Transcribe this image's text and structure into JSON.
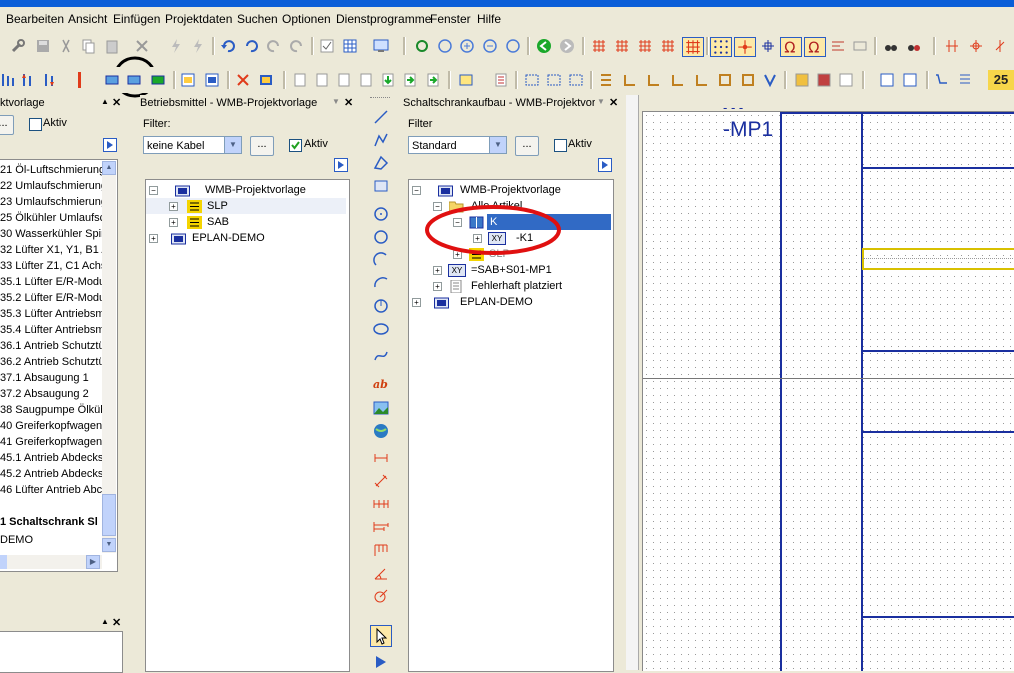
{
  "menu": [
    "Bearbeiten",
    "Ansicht",
    "Einfügen",
    "Projektdaten",
    "Suchen",
    "Optionen",
    "Dienstprogramme",
    "Fenster",
    "Hilfe"
  ],
  "panel_left": {
    "title": "ktvorlage",
    "active_label": "Aktiv",
    "items": [
      "21 Öl-Luftschmierung",
      "22 Umlaufschmierung",
      "23 Umlaufschmierung",
      "25 Ölkühler Umlaufsch",
      "30 Wasserkühler Spin",
      "32 Lüfter X1, Y1, B1 A",
      "33 Lüfter Z1, C1 Achs",
      "35.1 Lüfter E/R-Modu",
      "35.2 Lüfter E/R-Modu",
      "35.3 Lüfter Antriebsm",
      "35.4 Lüfter Antriebsm",
      "36.1 Antrieb Schutztü",
      "36.2 Antrieb Schutztü",
      "37.1 Absaugung 1",
      "37.2 Absaugung 2",
      "38 Saugpumpe Ölkühl",
      "40 Greiferkopfwagen",
      "41 Greiferkopfwagen",
      "45.1 Antrieb Abdecks",
      "45.2 Antrieb Abdecks",
      "46 Lüfter Antrieb Abc"
    ],
    "bold_item": "1 Schaltschrank Sl",
    "last_item": "DEMO"
  },
  "panel_mid": {
    "title": "Betriebsmittel - WMB-Projektvorlage",
    "filter_label": "Filter:",
    "filter_value": "keine Kabel",
    "active_label": "Aktiv",
    "tree": [
      "WMB-Projektvorlage",
      "SLP",
      "SAB",
      "EPLAN-DEMO"
    ]
  },
  "panel_right": {
    "title": "Schaltschrankaufbau - WMB-Projektvor",
    "filter_label": "Filter",
    "filter_value": "Standard",
    "active_label": "Aktiv",
    "tree": [
      "WMB-Projektvorlage",
      "Alle Artikel",
      "K",
      "-K1",
      "SLP",
      "=SAB+S01-MP1",
      "Fehlerhaft platziert",
      "EPLAN-DEMO"
    ],
    "xy_badge": "XY"
  },
  "canvas": {
    "label": "-MP1",
    "top_label": "- - -"
  },
  "toolbar2_badge": "25",
  "colors": {
    "accent_blue": "#1a2f9f",
    "selection": "#316ac5",
    "annotation_red": "#e01010",
    "annotation_black": "#000000"
  }
}
